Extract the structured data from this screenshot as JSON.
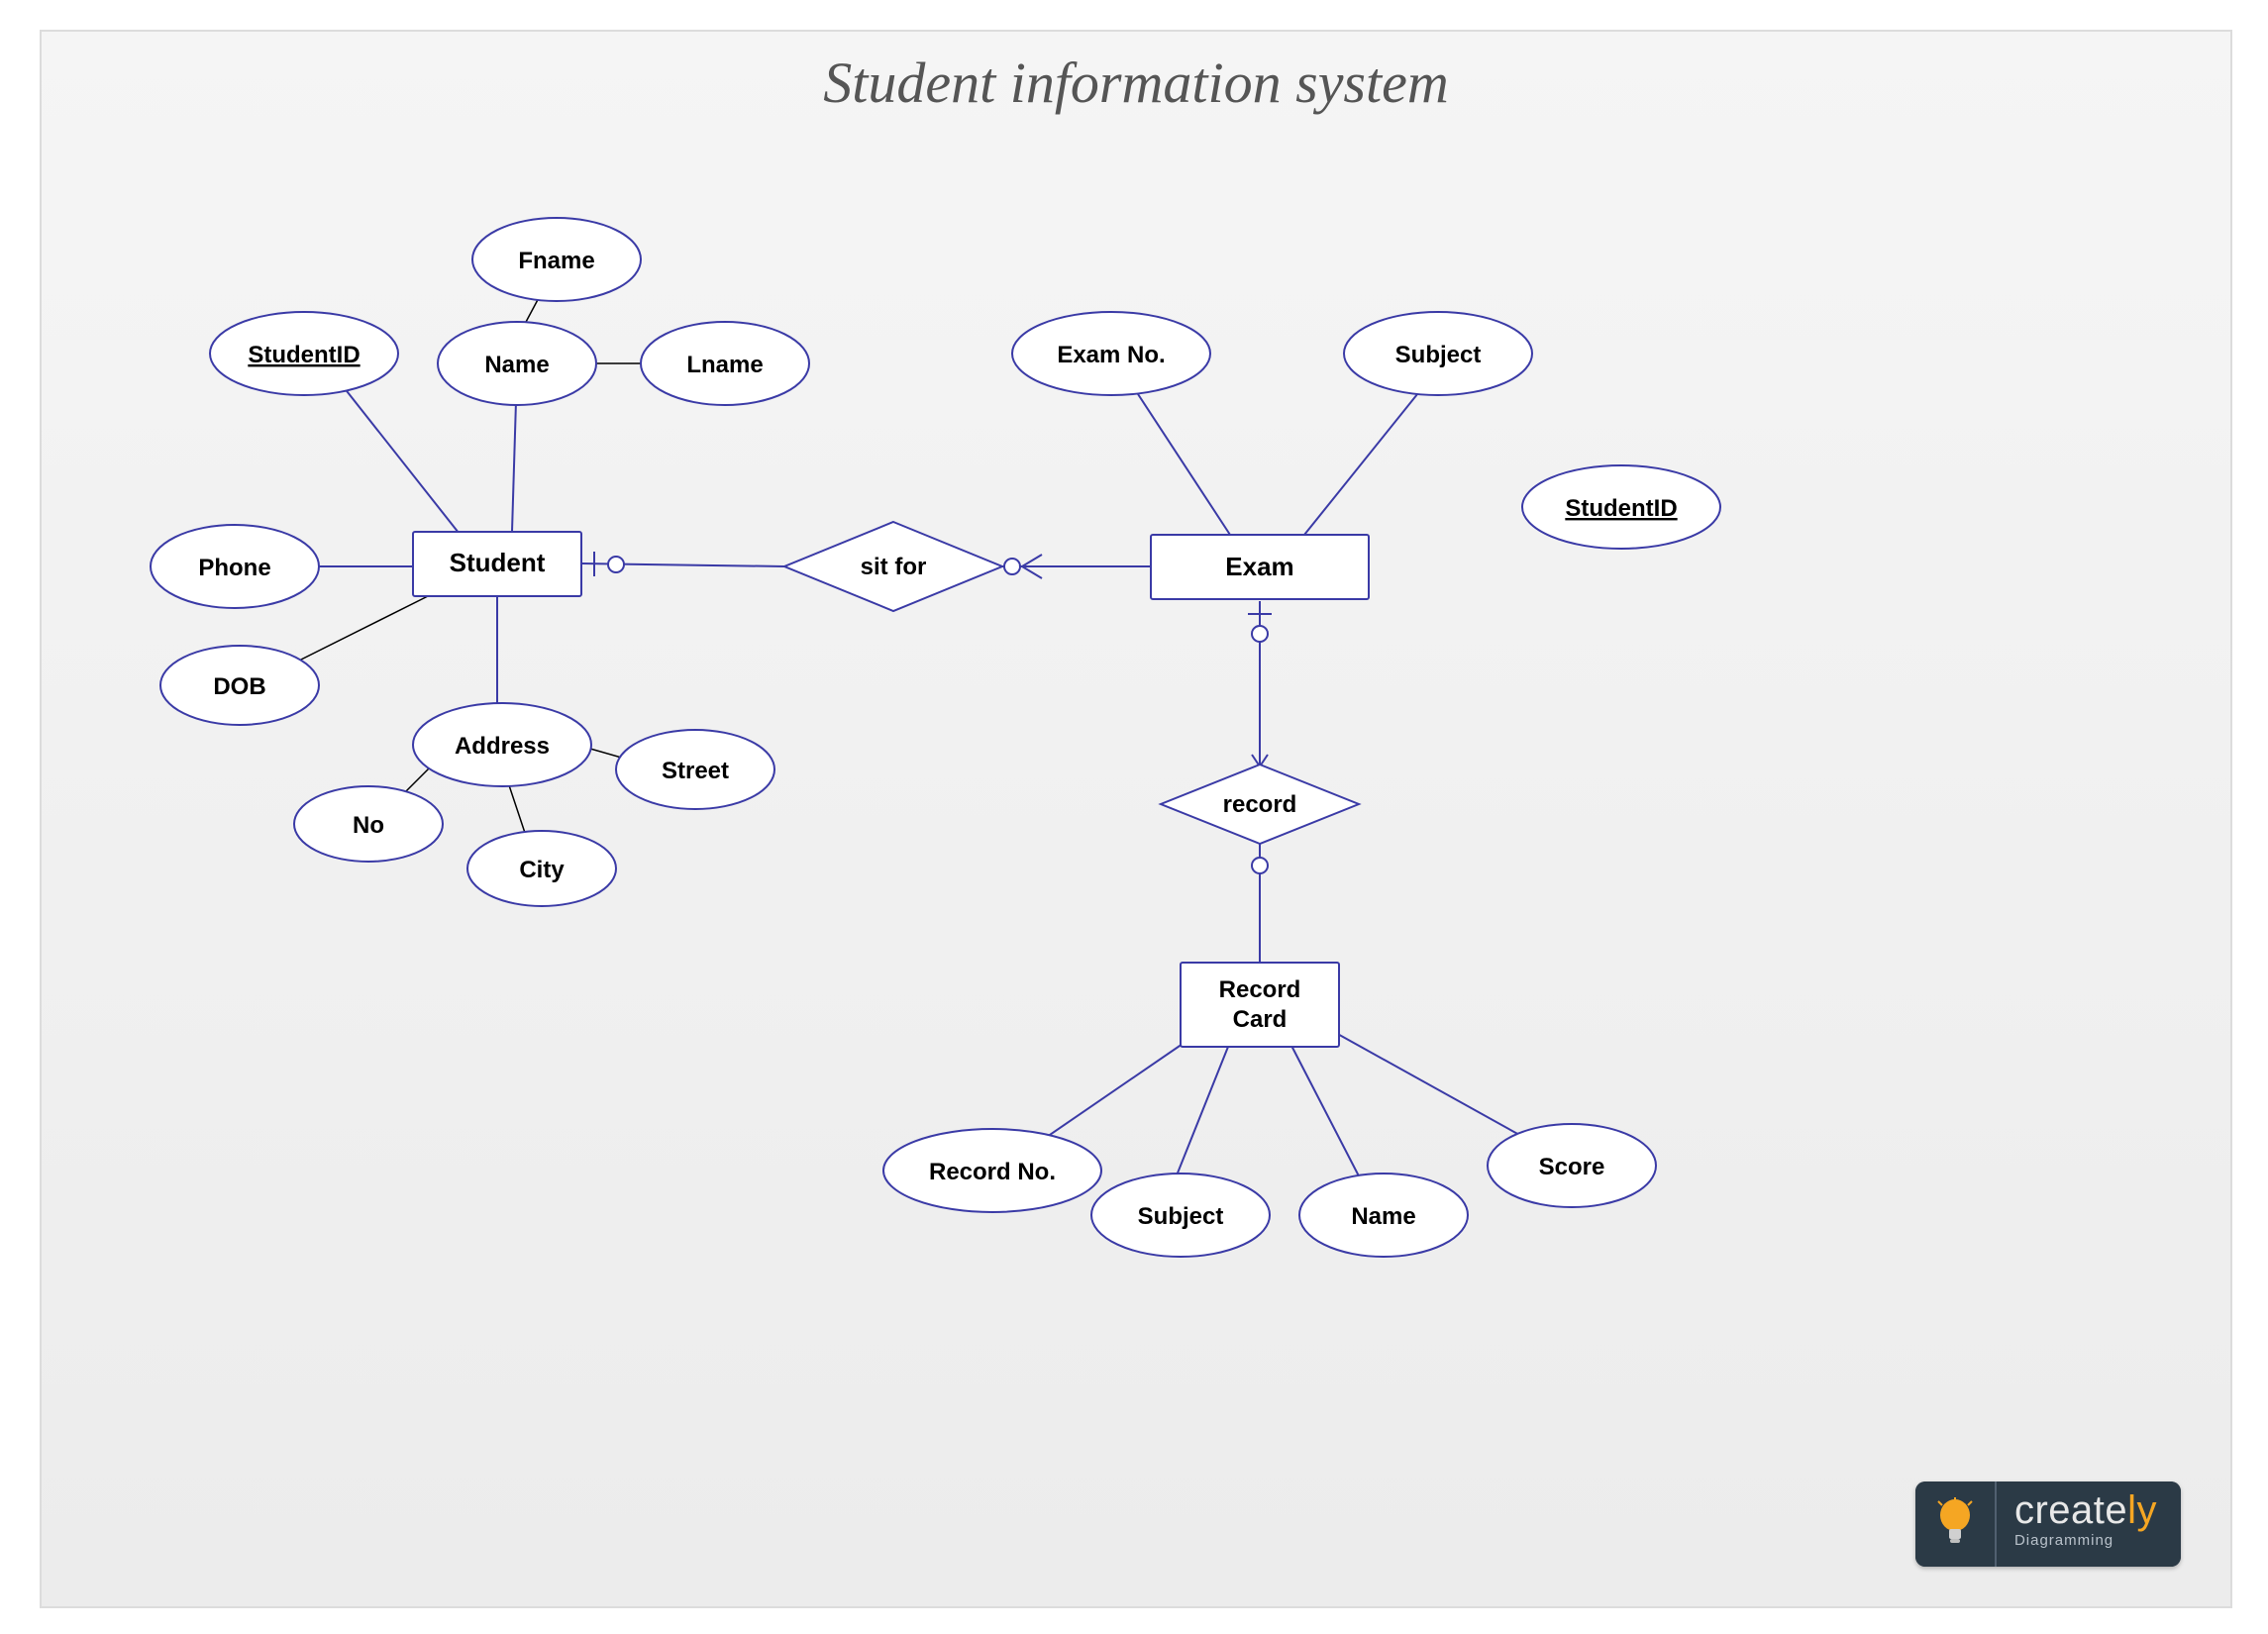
{
  "title": "Student information system",
  "entities": {
    "student": "Student",
    "exam": "Exam",
    "record_card_l1": "Record",
    "record_card_l2": "Card"
  },
  "relationships": {
    "sit_for": "sit for",
    "record": "record"
  },
  "attrs": {
    "student": {
      "student_id": "StudentID",
      "student_id_underline": true,
      "name": "Name",
      "fname": "Fname",
      "lname": "Lname",
      "phone": "Phone",
      "dob": "DOB",
      "address": "Address",
      "address_no": "No",
      "address_city": "City",
      "address_street": "Street"
    },
    "exam": {
      "exam_no": "Exam No.",
      "subject": "Subject",
      "student_id": "StudentID",
      "student_id_underline": true
    },
    "record_card": {
      "record_no": "Record No.",
      "subject": "Subject",
      "name": "Name",
      "score": "Score"
    }
  },
  "logo": {
    "name_left": "create",
    "name_right": "ly",
    "tag": "Diagramming"
  }
}
